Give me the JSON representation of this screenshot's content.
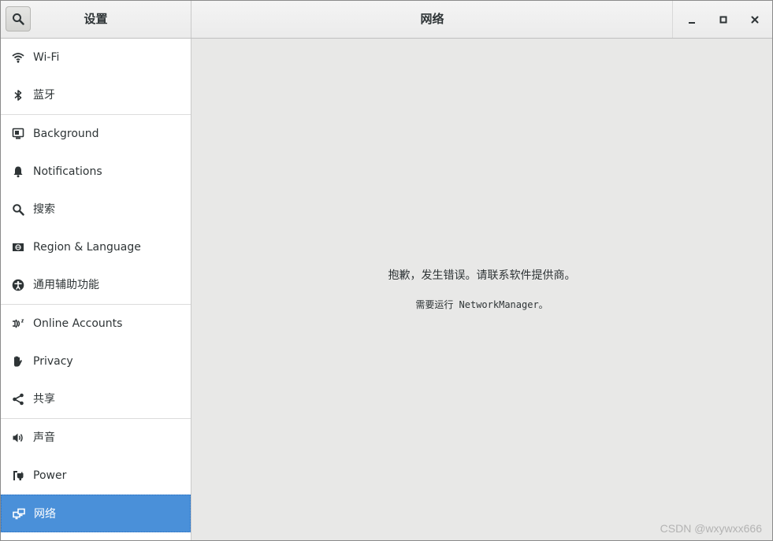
{
  "header": {
    "sidebar_title": "设置",
    "main_title": "网络"
  },
  "window_controls": {
    "minimize": "minimize-icon",
    "maximize": "maximize-icon",
    "close": "close-icon"
  },
  "sidebar": {
    "items": [
      {
        "label": "Wi-Fi",
        "icon": "wifi-icon"
      },
      {
        "label": "蓝牙",
        "icon": "bluetooth-icon"
      },
      {
        "label": "Background",
        "icon": "background-icon"
      },
      {
        "label": "Notifications",
        "icon": "bell-icon"
      },
      {
        "label": "搜索",
        "icon": "search-icon"
      },
      {
        "label": "Region & Language",
        "icon": "region-icon"
      },
      {
        "label": "通用辅助功能",
        "icon": "accessibility-icon"
      },
      {
        "label": "Online Accounts",
        "icon": "online-accounts-icon"
      },
      {
        "label": "Privacy",
        "icon": "hand-icon"
      },
      {
        "label": "共享",
        "icon": "share-icon"
      },
      {
        "label": "声音",
        "icon": "speaker-icon"
      },
      {
        "label": "Power",
        "icon": "power-plug-icon"
      },
      {
        "label": "网络",
        "icon": "network-icon",
        "selected": true
      }
    ]
  },
  "main": {
    "error_message": "抱歉，发生错误。请联系软件提供商。",
    "error_detail": "需要运行 NetworkManager。"
  },
  "watermark": "CSDN @wxywxx666",
  "colors": {
    "selected": "#4a90d9",
    "content_bg": "#e8e8e7",
    "sidebar_bg": "#ffffff"
  }
}
